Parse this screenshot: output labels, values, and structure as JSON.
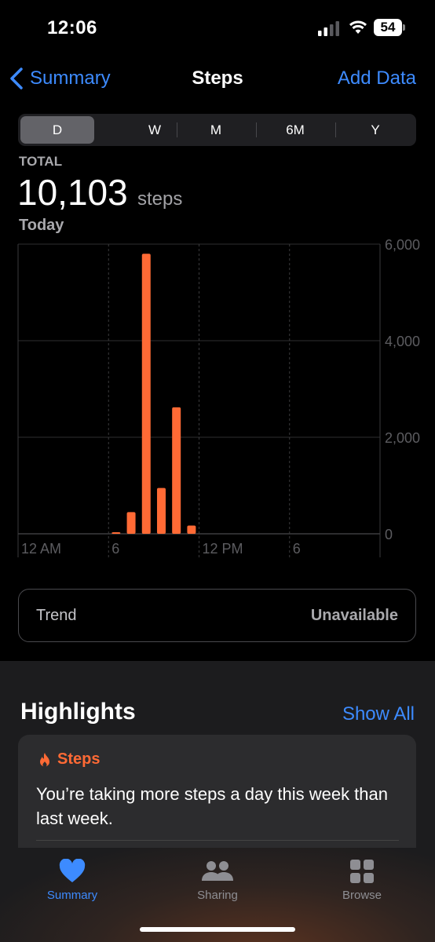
{
  "status": {
    "time": "12:06",
    "battery": "54"
  },
  "nav": {
    "back_label": "Summary",
    "title": "Steps",
    "add_label": "Add Data"
  },
  "segments": [
    "D",
    "W",
    "M",
    "6M",
    "Y"
  ],
  "summary": {
    "total_label": "TOTAL",
    "value": "10,103",
    "unit": "steps",
    "period": "Today"
  },
  "chart_data": {
    "type": "bar",
    "y_ticks": [
      "6,000",
      "4,000",
      "2,000",
      "0"
    ],
    "ylim": [
      0,
      6000
    ],
    "x_ticks": [
      "12 AM",
      "6",
      "12 PM",
      "6"
    ],
    "x_hours": [
      0,
      6,
      12,
      18
    ],
    "x_range": [
      0,
      24
    ],
    "bar_color": "#ff6a35",
    "bars": [
      {
        "hour": 6,
        "steps": 30
      },
      {
        "hour": 7,
        "steps": 450
      },
      {
        "hour": 8,
        "steps": 5800
      },
      {
        "hour": 9,
        "steps": 950
      },
      {
        "hour": 10,
        "steps": 2620
      },
      {
        "hour": 11,
        "steps": 170
      }
    ]
  },
  "trend": {
    "label": "Trend",
    "value": "Unavailable"
  },
  "highlights": {
    "title": "Highlights",
    "show_all": "Show All",
    "card": {
      "category": "Steps",
      "text": "You’re taking more steps a day this week than last week."
    }
  },
  "tabs": [
    {
      "label": "Summary",
      "icon": "heart-icon",
      "active": true
    },
    {
      "label": "Sharing",
      "icon": "people-icon",
      "active": false
    },
    {
      "label": "Browse",
      "icon": "grid-icon",
      "active": false
    }
  ],
  "colors": {
    "accent": "#3d8bff",
    "orange": "#ff6a35",
    "background": "#000000"
  }
}
